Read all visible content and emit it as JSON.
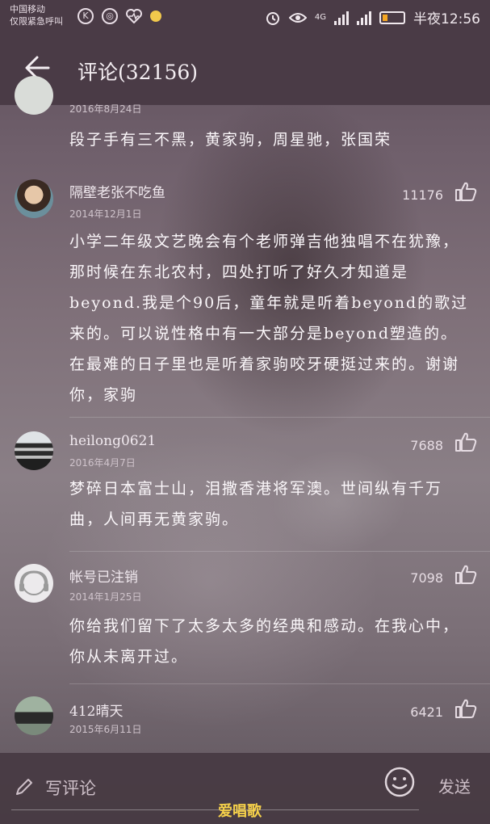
{
  "status_bar": {
    "carrier_line1": "中国移动",
    "carrier_line2": "仅限紧急呼叫",
    "network": "4G",
    "time": "半夜12:56",
    "battery_level": 0.25
  },
  "header": {
    "title": "评论(32156)"
  },
  "comments": [
    {
      "username": "",
      "date": "2016年8月24日",
      "likes": "",
      "text": "段子手有三不黑，黄家驹，周星驰，张国荣"
    },
    {
      "username": "隔壁老张不吃鱼",
      "date": "2014年12月1日",
      "likes": "11176",
      "text": "小学二年级文艺晚会有个老师弹吉他独唱不在犹豫，那时候在东北农村，四处打听了好久才知道是beyond.我是个90后，童年就是听着beyond的歌过来的。可以说性格中有一大部分是beyond塑造的。在最难的日子里也是听着家驹咬牙硬挺过来的。谢谢你，家驹"
    },
    {
      "username": "heilong0621",
      "date": "2016年4月7日",
      "likes": "7688",
      "text": "梦碎日本富士山，泪撒香港将军澳。世间纵有千万曲，人间再无黄家驹。"
    },
    {
      "username": "帐号已注销",
      "date": "2014年1月25日",
      "likes": "7098",
      "text": "你给我们留下了太多太多的经典和感动。在我心中，你从未离开过。"
    },
    {
      "username": "412晴天",
      "date": "2015年6月11日",
      "likes": "6421",
      "text": ""
    }
  ],
  "bottom_bar": {
    "input_placeholder": "写评论",
    "send_label": "发送"
  },
  "watermark": "爱唱歌",
  "colors": {
    "bar_bg": "#4a3b46",
    "text": "#fbf7fa",
    "watermark": "#f5d04a",
    "battery": "#f5a623"
  },
  "icons": {
    "back": "arrow-left-icon",
    "like": "thumbs-up-icon",
    "pencil": "pencil-icon",
    "emoji": "smile-icon"
  }
}
